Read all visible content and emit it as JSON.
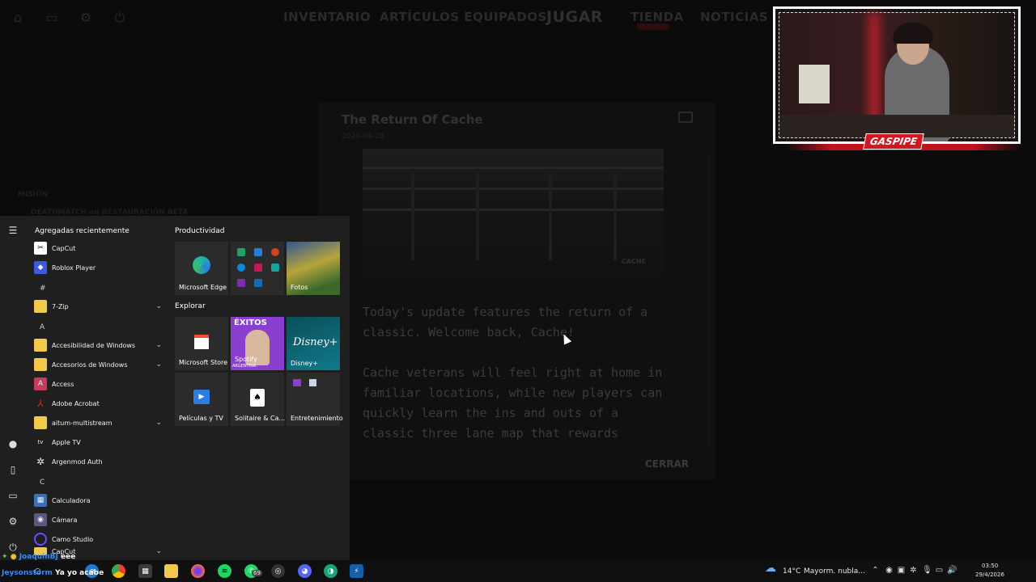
{
  "game": {
    "nav_tabs": [
      "INVENTARIO",
      "ARTÍCULOS EQUIPADOS",
      "JUGAR",
      "TIENDA",
      "NOTICIAS"
    ],
    "store_badge": "ESTRENO",
    "side_line1": "MISIÓN",
    "side_line2": "DEATHMATCH en RESTAURACIÓN BETA",
    "news": {
      "title": "The Return Of Cache",
      "date": "2026-04-28",
      "image_watermark": "CACHE",
      "body_p1": "Today's update features the return of a classic. Welcome back, Cache!",
      "body_p2": "Cache veterans will feel right at home in familiar locations, while new players can quickly learn the ins and outs of a classic three lane map that rewards",
      "close_label": "CERRAR"
    }
  },
  "webcam": {
    "streamer_name": "GASPIPE"
  },
  "start_menu": {
    "recent_header": "Agregadas recientemente",
    "recent": [
      {
        "label": "CapCut",
        "icon": "capcut-icon",
        "color": "#ffffff"
      },
      {
        "label": "Roblox Player",
        "icon": "roblox-icon",
        "color": "#3b5bdb"
      }
    ],
    "letters": [
      "#",
      "A",
      "C"
    ],
    "apps": [
      {
        "label": "7-Zip",
        "icon": "folder-icon",
        "color": "#f2c94c",
        "expandable": true
      },
      {
        "label": "Accesibilidad de Windows",
        "icon": "folder-icon",
        "color": "#f2c94c",
        "expandable": true
      },
      {
        "label": "Accesorios de Windows",
        "icon": "folder-icon",
        "color": "#f2c94c",
        "expandable": true
      },
      {
        "label": "Access",
        "icon": "access-icon",
        "color": "#c43e5c"
      },
      {
        "label": "Adobe Acrobat",
        "icon": "acrobat-icon",
        "color": "#e02020"
      },
      {
        "label": "aitum-multistream",
        "icon": "folder-icon",
        "color": "#f2c94c",
        "expandable": true
      },
      {
        "label": "Apple TV",
        "icon": "appletv-icon",
        "color": "#1a1a1a"
      },
      {
        "label": "Argenmod Auth",
        "icon": "argenmod-icon",
        "color": "#444"
      },
      {
        "label": "Calculadora",
        "icon": "calculator-icon",
        "color": "#3b6fb6"
      },
      {
        "label": "Cámara",
        "icon": "camera-icon",
        "color": "#6a6a8a"
      },
      {
        "label": "Camo Studio",
        "icon": "camo-icon",
        "color": "#6c4cff"
      },
      {
        "label": "CapCut",
        "icon": "folder-icon",
        "color": "#f2c94c",
        "expandable": true
      }
    ],
    "productivity_header": "Productividad",
    "explore_header": "Explorar",
    "tiles": {
      "edge": "Microsoft Edge",
      "fotos": "Fotos",
      "store": "Microsoft Store",
      "spotify": "Spotify",
      "spotify_art_title": "ÉXITOS",
      "spotify_art_sub": "ARGENTINA",
      "disney": "Disney+",
      "disney_logo": "Disney+",
      "movies": "Películas y TV",
      "solitaire": "Solitaire & Ca...",
      "entertainment": "Entretenimiento"
    }
  },
  "taskbar": {
    "chat_user1": "JoaquinBJ",
    "chat_msg1": "eee",
    "chat_user2": "Jeysonstorm",
    "chat_msg2": "Ya yo acabe",
    "whatsapp_badge": "69",
    "weather_temp": "14°C",
    "weather_desc": "Mayorm. nubla...",
    "time": "03:50",
    "date": "29/4/2026"
  }
}
